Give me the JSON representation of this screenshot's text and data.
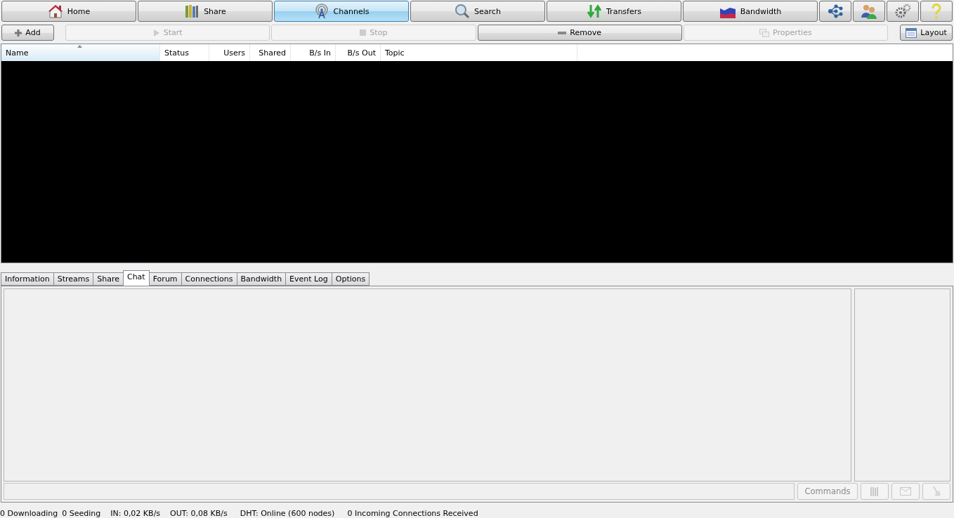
{
  "nav": [
    {
      "label": "Home",
      "selected": false
    },
    {
      "label": "Share",
      "selected": false
    },
    {
      "label": "Channels",
      "selected": true
    },
    {
      "label": "Search",
      "selected": false
    },
    {
      "label": "Transfers",
      "selected": false
    },
    {
      "label": "Bandwidth",
      "selected": false
    }
  ],
  "toolbar": [
    {
      "label": "Add",
      "disabled": false
    },
    {
      "label": "Start",
      "disabled": true
    },
    {
      "label": "Stop",
      "disabled": true
    },
    {
      "label": "Remove",
      "disabled": false
    },
    {
      "label": "Properties",
      "disabled": true
    }
  ],
  "layout_button": "Layout",
  "table": {
    "columns": [
      {
        "label": "Name",
        "sorted": true
      },
      {
        "label": "Status",
        "sorted": false
      },
      {
        "label": "Users",
        "sorted": false
      },
      {
        "label": "Shared",
        "sorted": false
      },
      {
        "label": "B/s In",
        "sorted": false
      },
      {
        "label": "B/s Out",
        "sorted": false
      },
      {
        "label": "Topic",
        "sorted": false
      }
    ]
  },
  "tabs": [
    {
      "label": "Information",
      "selected": false
    },
    {
      "label": "Streams",
      "selected": false
    },
    {
      "label": "Share",
      "selected": false
    },
    {
      "label": "Chat",
      "selected": true
    },
    {
      "label": "Forum",
      "selected": false
    },
    {
      "label": "Connections",
      "selected": false
    },
    {
      "label": "Bandwidth",
      "selected": false
    },
    {
      "label": "Event Log",
      "selected": false
    },
    {
      "label": "Options",
      "selected": false
    }
  ],
  "chat": {
    "commands_button": "Commands"
  },
  "status_bar": [
    "0 Downloading",
    "0 Seeding",
    "IN: 0,02 KB/s",
    "OUT: 0,08 KB/s",
    "DHT: Online (600 nodes)",
    "0 Incoming Connections Received"
  ]
}
